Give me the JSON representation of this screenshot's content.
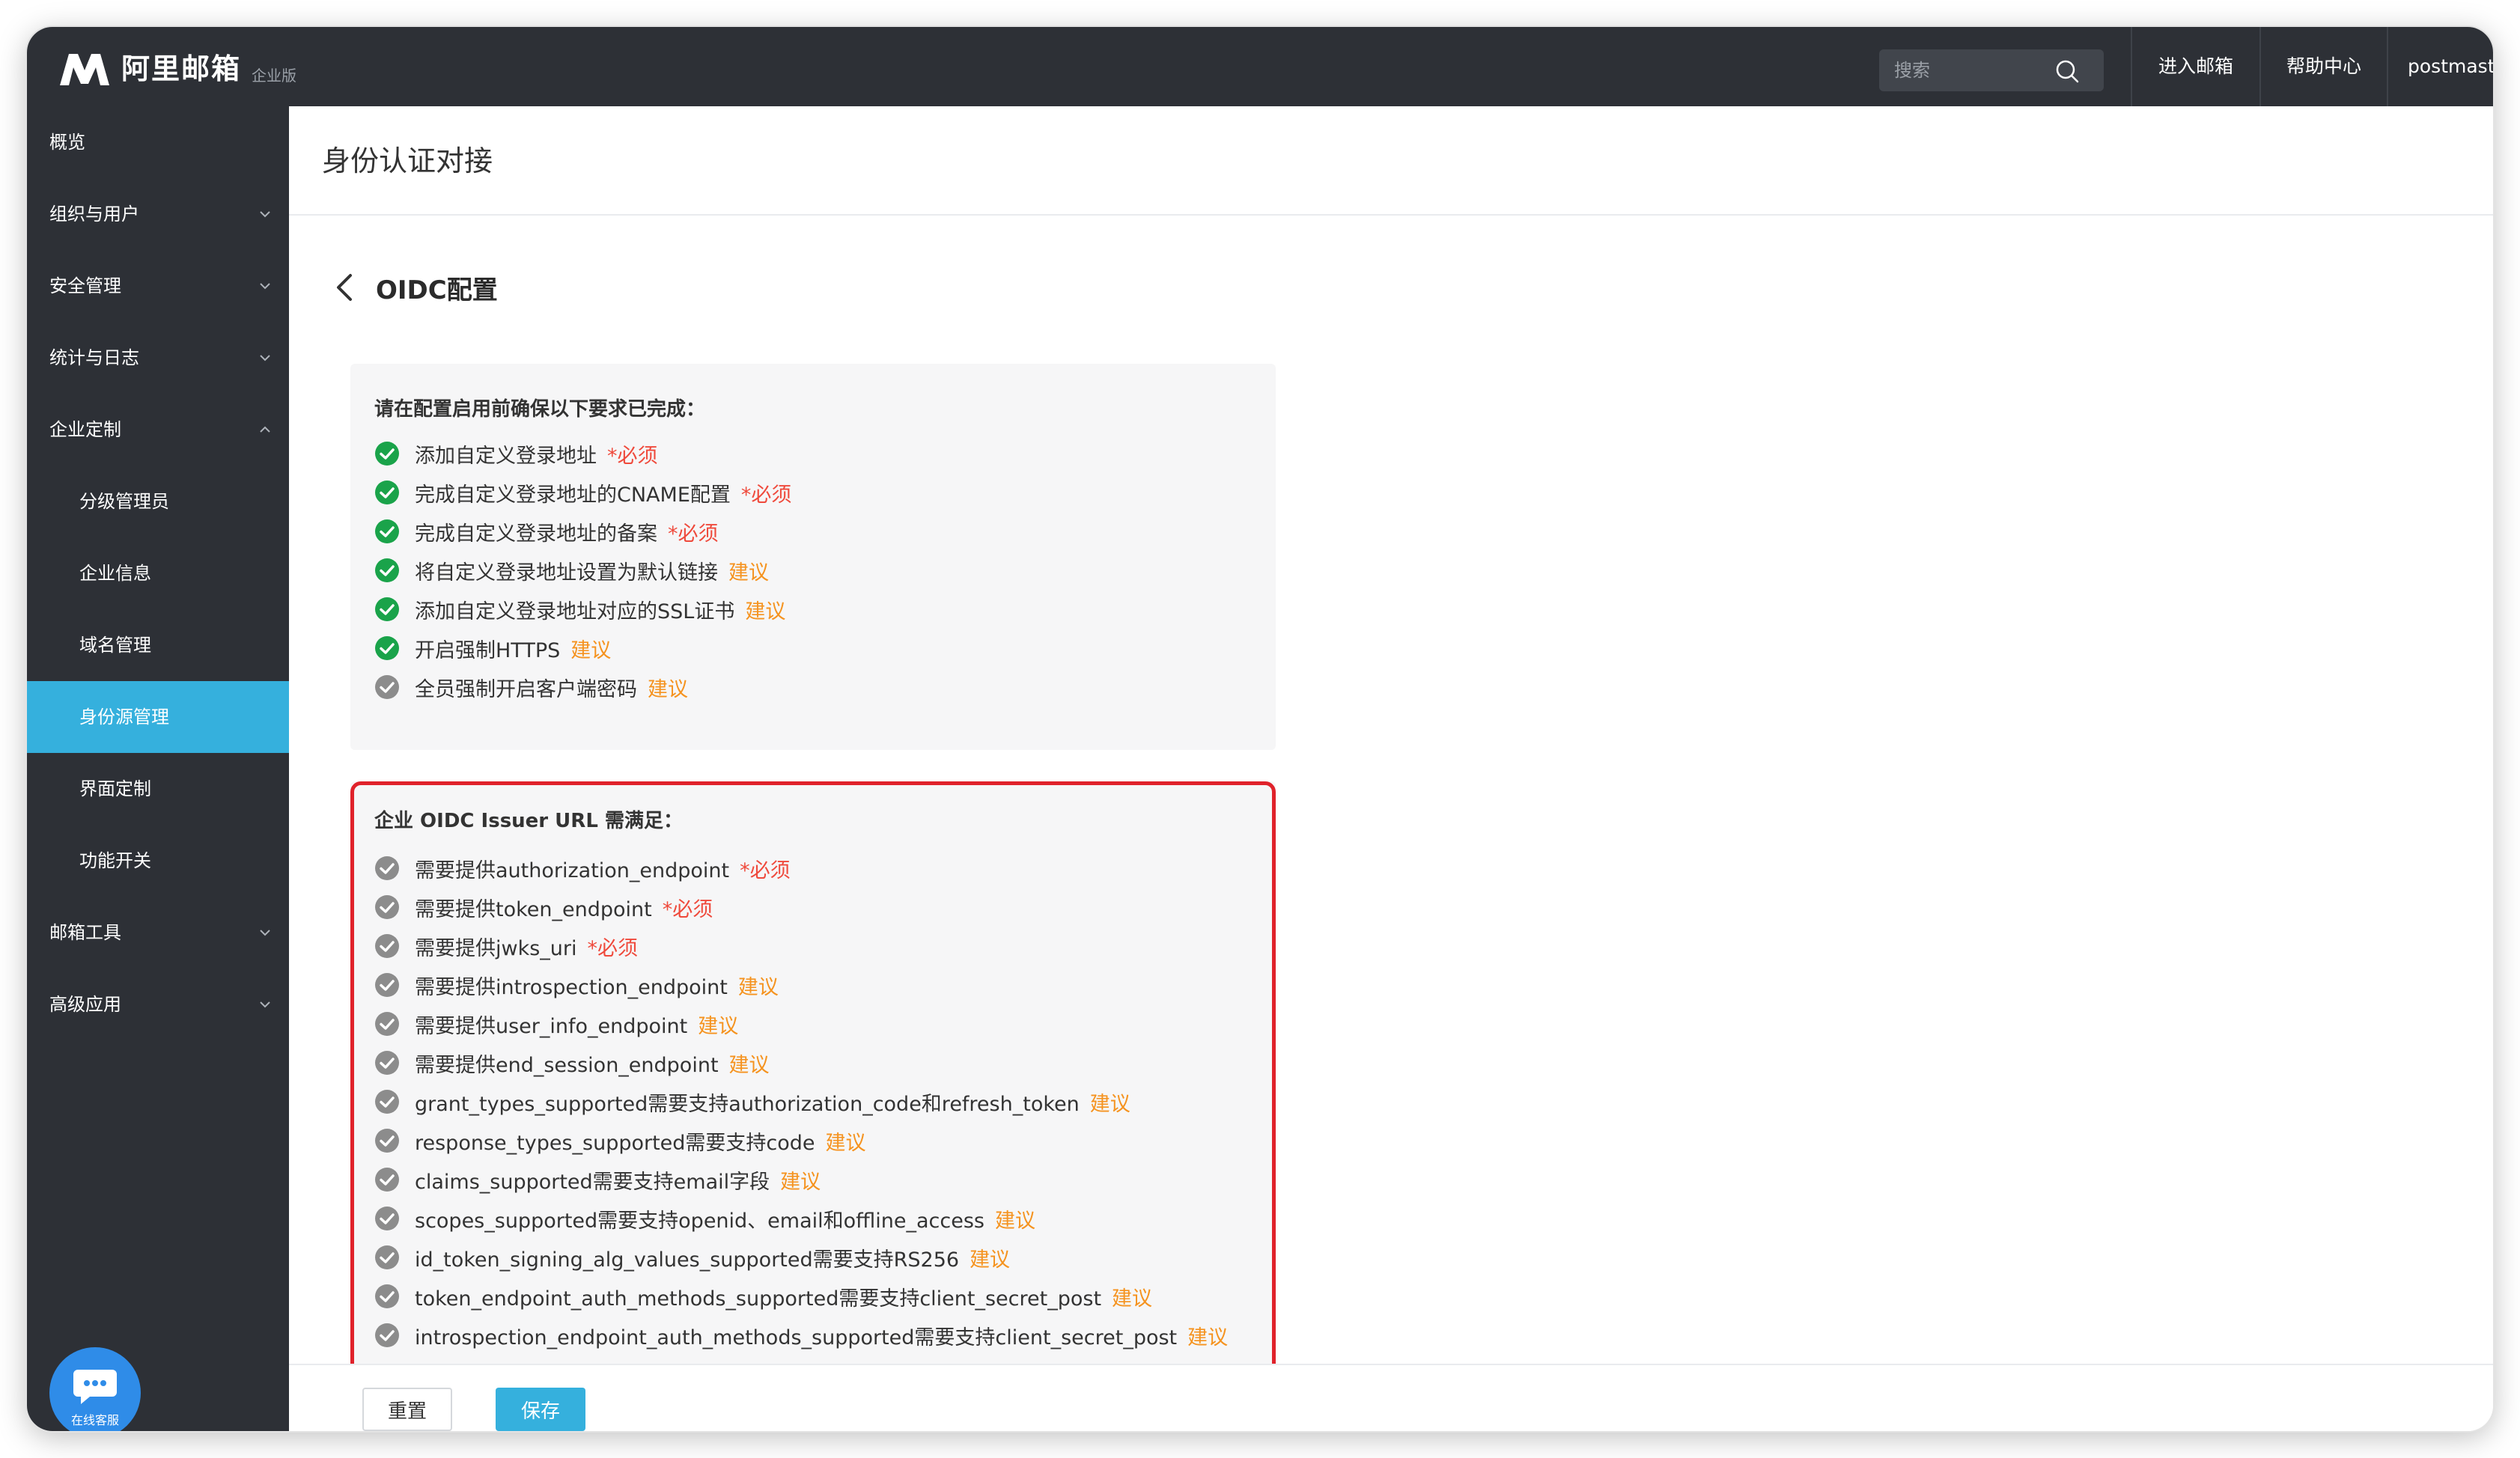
{
  "topbar": {
    "logo_text": "阿里邮箱",
    "logo_badge": "企业版",
    "search_placeholder": "搜索",
    "links": [
      "进入邮箱",
      "帮助中心",
      "postmaster"
    ]
  },
  "sidebar": {
    "items": [
      {
        "label": "概览",
        "chevron": "none"
      },
      {
        "label": "组织与用户",
        "chevron": "down"
      },
      {
        "label": "安全管理",
        "chevron": "down"
      },
      {
        "label": "统计与日志",
        "chevron": "down"
      },
      {
        "label": "企业定制",
        "chevron": "up"
      },
      {
        "label": "分级管理员",
        "sub": true
      },
      {
        "label": "企业信息",
        "sub": true
      },
      {
        "label": "域名管理",
        "sub": true
      },
      {
        "label": "身份源管理",
        "sub": true,
        "active": true
      },
      {
        "label": "界面定制",
        "sub": true
      },
      {
        "label": "功能开关",
        "sub": true
      },
      {
        "label": "邮箱工具",
        "chevron": "down"
      },
      {
        "label": "高级应用",
        "chevron": "down"
      }
    ]
  },
  "chat": {
    "label": "在线客服"
  },
  "main": {
    "page_title": "身份认证对接",
    "section_title": "OIDC配置",
    "prereq": {
      "heading": "请在配置启用前确保以下要求已完成：",
      "items": [
        {
          "text": "添加自定义登录地址",
          "tag": "*必须",
          "tag_type": "required",
          "status": "done"
        },
        {
          "text": "完成自定义登录地址的CNAME配置",
          "tag": "*必须",
          "tag_type": "required",
          "status": "done"
        },
        {
          "text": "完成自定义登录地址的备案",
          "tag": "*必须",
          "tag_type": "required",
          "status": "done"
        },
        {
          "text": "将自定义登录地址设置为默认链接",
          "tag": "建议",
          "tag_type": "suggest",
          "status": "done"
        },
        {
          "text": "添加自定义登录地址对应的SSL证书",
          "tag": "建议",
          "tag_type": "suggest",
          "status": "done"
        },
        {
          "text": "开启强制HTTPS",
          "tag": "建议",
          "tag_type": "suggest",
          "status": "done"
        },
        {
          "text": "全员强制开启客户端密码",
          "tag": "建议",
          "tag_type": "suggest",
          "status": "pending"
        }
      ]
    },
    "issuer": {
      "heading": "企业 OIDC Issuer URL 需满足：",
      "items": [
        {
          "text": "需要提供authorization_endpoint",
          "tag": "*必须",
          "tag_type": "required"
        },
        {
          "text": "需要提供token_endpoint",
          "tag": "*必须",
          "tag_type": "required"
        },
        {
          "text": "需要提供jwks_uri",
          "tag": "*必须",
          "tag_type": "required"
        },
        {
          "text": "需要提供introspection_endpoint",
          "tag": "建议",
          "tag_type": "suggest"
        },
        {
          "text": "需要提供user_info_endpoint",
          "tag": "建议",
          "tag_type": "suggest"
        },
        {
          "text": "需要提供end_session_endpoint",
          "tag": "建议",
          "tag_type": "suggest"
        },
        {
          "text": "grant_types_supported需要支持authorization_code和refresh_token",
          "tag": "建议",
          "tag_type": "suggest"
        },
        {
          "text": "response_types_supported需要支持code",
          "tag": "建议",
          "tag_type": "suggest"
        },
        {
          "text": "claims_supported需要支持email字段",
          "tag": "建议",
          "tag_type": "suggest"
        },
        {
          "text": "scopes_supported需要支持openid、email和offline_access",
          "tag": "建议",
          "tag_type": "suggest"
        },
        {
          "text": "id_token_signing_alg_values_supported需要支持RS256",
          "tag": "建议",
          "tag_type": "suggest"
        },
        {
          "text": "token_endpoint_auth_methods_supported需要支持client_secret_post",
          "tag": "建议",
          "tag_type": "suggest"
        },
        {
          "text": "introspection_endpoint_auth_methods_supported需要支持client_secret_post",
          "tag": "建议",
          "tag_type": "suggest"
        }
      ]
    },
    "buttons": {
      "reset": "重置",
      "save": "保存"
    }
  },
  "colors": {
    "topbar_bg": "#2d3036",
    "accent": "#35b0dd",
    "check_done": "#1aa34a",
    "check_pending": "#8c8c8c",
    "required": "#ef4a3c",
    "suggest": "#f5931f",
    "highlight_border": "#e0222b"
  }
}
